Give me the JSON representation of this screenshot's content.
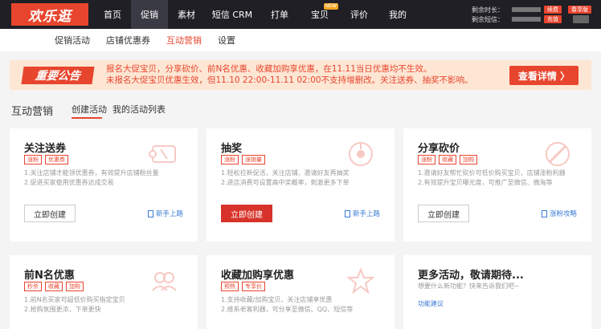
{
  "app": {
    "logo": "欢乐逛",
    "nav": [
      {
        "label": "首页",
        "active": false
      },
      {
        "label": "促销",
        "active": true
      },
      {
        "label": "素材",
        "active": false
      },
      {
        "label": "短信 CRM",
        "active": false
      },
      {
        "label": "打单",
        "active": false
      },
      {
        "label": "宝贝",
        "active": false,
        "badge": "NEW"
      },
      {
        "label": "评价",
        "active": false
      },
      {
        "label": "我的",
        "active": false
      }
    ],
    "account": {
      "time_label": "剩余时长：",
      "renew": "续费",
      "trial": "春享版",
      "sms_label": "剩余短信：",
      "recharge": "充值"
    }
  },
  "subnav": [
    {
      "label": "促销活动",
      "active": false
    },
    {
      "label": "店铺优惠券",
      "active": false
    },
    {
      "label": "互动营销",
      "active": true
    },
    {
      "label": "设置",
      "active": false
    }
  ],
  "notice": {
    "tag": "重要公告",
    "line1": "报名大促宝贝，分享砍价、前N名优惠、收藏加购享优惠，在11.11当日优惠均不生效。",
    "line2": "未报名大促宝贝优惠生效，但11.10 22:00-11.11 02:00不支持增删改。关注送券、抽奖不影响。",
    "button": "查看详情 〉"
  },
  "section": {
    "title": "互动营销",
    "tabs": [
      "创建活动",
      "我的活动列表"
    ]
  },
  "cards": [
    {
      "title": "关注送券",
      "tags": [
        "涨粉",
        "优惠券"
      ],
      "desc": [
        "1.关注店铺才能领优惠券，有效提升店铺粉丝量",
        "2.促进买家使用优惠券达成交易"
      ],
      "button": "立即创建",
      "link": "新手上路",
      "icon": "ticket-icon"
    },
    {
      "title": "抽奖",
      "tags": [
        "涨粉",
        "涨销量"
      ],
      "desc": [
        "1.轻松拉新促活，关注店铺、邀请好友再抽奖",
        "2.进店消费可设置高中奖概率，刺激更多下单"
      ],
      "button": "立即创建",
      "link": "新手上路",
      "icon": "lottery-icon"
    },
    {
      "title": "分享砍价",
      "tags": [
        "涨粉",
        "收藏",
        "加购"
      ],
      "desc": [
        "1.邀请好友帮忙砍价可低价购买宝贝，店铺涨粉利器",
        "2.有效提升宝贝曝光度，可推广至微信、微淘等"
      ],
      "button": "立即创建",
      "link": "涨粉攻略",
      "icon": "knife-icon"
    },
    {
      "title": "前N名优惠",
      "tags": [
        "秒杀",
        "收藏",
        "加购"
      ],
      "desc": [
        "1.前N名买家可超低价购买指定宝贝",
        "2.抢购氛围更浓，下单更快"
      ],
      "icon": "group-icon"
    },
    {
      "title": "收藏加购享优惠",
      "tags": [
        "预热",
        "专享价"
      ],
      "desc": [
        "1.支持收藏/加购宝贝、关注店铺享优惠",
        "2.维系老客利器，可分享至微信、QQ、短信等"
      ],
      "icon": "star-icon"
    }
  ],
  "more": {
    "title": "更多活动，敬请期待...",
    "desc": "想要什么新功能？快来告诉我们吧~",
    "link": "功能建议"
  }
}
